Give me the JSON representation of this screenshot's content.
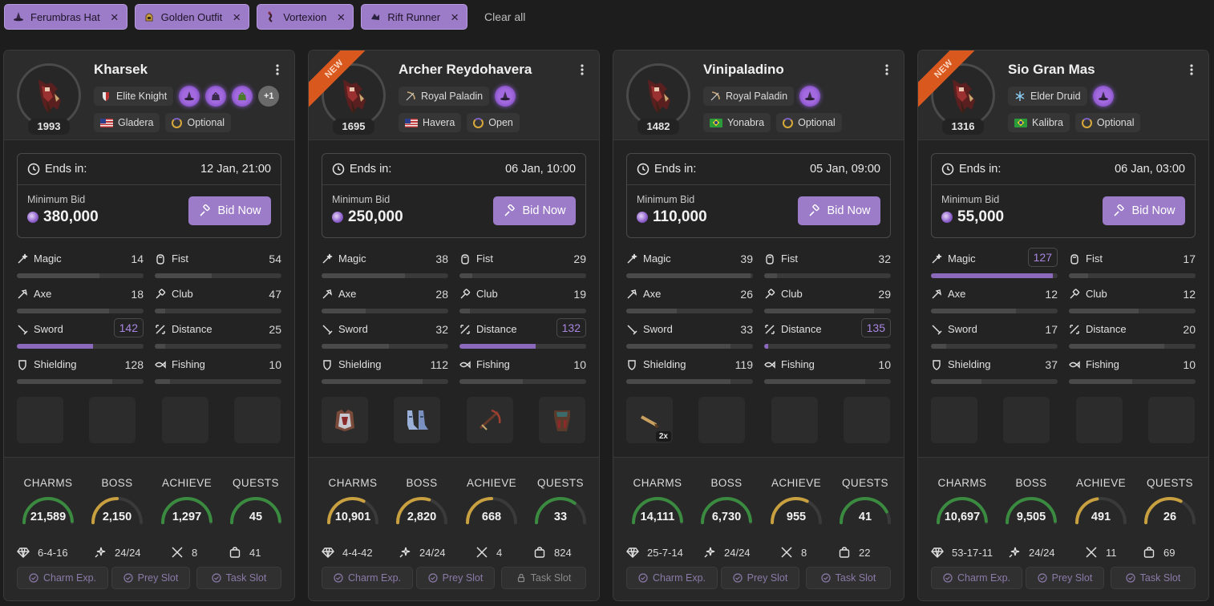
{
  "filters": [
    {
      "label": "Ferumbras Hat",
      "icon": "wizard-hat-icon"
    },
    {
      "label": "Golden Outfit",
      "icon": "golden-helmet-icon"
    },
    {
      "label": "Vortexion",
      "icon": "vortexion-mount-icon"
    },
    {
      "label": "Rift Runner",
      "icon": "rift-runner-mount-icon"
    }
  ],
  "clear_all": "Clear all",
  "labels": {
    "ends_in": "Ends in:",
    "minimum_bid": "Minimum Bid",
    "bid_now": "Bid Now",
    "new_badge": "NEW",
    "charms": "CHARMS",
    "boss": "BOSS",
    "achieve": "ACHIEVE",
    "quests": "QUESTS",
    "charm_exp": "Charm Exp.",
    "prey_slot": "Prey Slot",
    "task_slot": "Task Slot"
  },
  "colors": {
    "accent": "#9c7cc8",
    "ribbon": "#d8581e",
    "gauge_green": "#3a8a40",
    "gauge_gold": "#c8a040"
  },
  "cards": [
    {
      "name": "Kharsek",
      "level": "1993",
      "is_new": false,
      "vocation": "Elite Knight",
      "vocation_icon": "shield-icon",
      "server": "Gladera",
      "flag": "us",
      "pvp": "Optional",
      "imbue_orbs": [
        "wizard-hat-icon",
        "bag-icon",
        "green-bag-icon"
      ],
      "more_orbs": "+1",
      "ends_date": "12 Jan, 21:00",
      "min_bid": "380,000",
      "skills": [
        {
          "name": "Magic",
          "value": "14",
          "level": 0.65,
          "highlight": false
        },
        {
          "name": "Fist",
          "value": "54",
          "level": 0.45,
          "highlight": false
        },
        {
          "name": "Axe",
          "value": "18",
          "level": 0.73,
          "highlight": false
        },
        {
          "name": "Club",
          "value": "47",
          "level": 0.08,
          "highlight": false
        },
        {
          "name": "Sword",
          "value": "142",
          "level": 0.6,
          "highlight": true
        },
        {
          "name": "Distance",
          "value": "25",
          "level": 0.08,
          "highlight": false
        },
        {
          "name": "Shielding",
          "value": "128",
          "level": 0.75,
          "highlight": false
        },
        {
          "name": "Fishing",
          "value": "10",
          "level": 0.12,
          "highlight": false
        }
      ],
      "items": [],
      "stats": [
        {
          "key": "charms",
          "value": "21,589",
          "ratio": 0.98,
          "color": "green"
        },
        {
          "key": "boss",
          "value": "2,150",
          "ratio": 0.5,
          "color": "gold"
        },
        {
          "key": "achieve",
          "value": "1,297",
          "ratio": 0.98,
          "color": "green"
        },
        {
          "key": "quests",
          "value": "45",
          "ratio": 0.98,
          "color": "green"
        }
      ],
      "minis": {
        "gems": "6-4-16",
        "prey": "24/24",
        "hunting": "8",
        "store": "41"
      },
      "perks": {
        "charm_exp": true,
        "prey_slot": true,
        "task_slot": true
      }
    },
    {
      "name": "Archer Reydohavera",
      "level": "1695",
      "is_new": true,
      "vocation": "Royal Paladin",
      "vocation_icon": "bow-icon",
      "server": "Havera",
      "flag": "us",
      "pvp": "Open",
      "imbue_orbs": [
        "wizard-hat-icon"
      ],
      "more_orbs": "",
      "ends_date": "06 Jan, 10:00",
      "min_bid": "250,000",
      "skills": [
        {
          "name": "Magic",
          "value": "38",
          "level": 0.66,
          "highlight": false
        },
        {
          "name": "Fist",
          "value": "29",
          "level": 0.1,
          "highlight": false
        },
        {
          "name": "Axe",
          "value": "28",
          "level": 0.35,
          "highlight": false
        },
        {
          "name": "Club",
          "value": "19",
          "level": 0.08,
          "highlight": false
        },
        {
          "name": "Sword",
          "value": "32",
          "level": 0.53,
          "highlight": false
        },
        {
          "name": "Distance",
          "value": "132",
          "level": 0.6,
          "highlight": true
        },
        {
          "name": "Shielding",
          "value": "112",
          "level": 0.8,
          "highlight": false
        },
        {
          "name": "Fishing",
          "value": "10",
          "level": 0.5,
          "highlight": false
        }
      ],
      "items": [
        {
          "icon": "armor-icon",
          "count": ""
        },
        {
          "icon": "boots-icon",
          "count": ""
        },
        {
          "icon": "crossbow-icon",
          "count": ""
        },
        {
          "icon": "legs-icon",
          "count": ""
        }
      ],
      "stats": [
        {
          "key": "charms",
          "value": "10,901",
          "ratio": 0.65,
          "color": "gold"
        },
        {
          "key": "boss",
          "value": "2,820",
          "ratio": 0.6,
          "color": "gold"
        },
        {
          "key": "achieve",
          "value": "668",
          "ratio": 0.5,
          "color": "gold"
        },
        {
          "key": "quests",
          "value": "33",
          "ratio": 0.7,
          "color": "green"
        }
      ],
      "minis": {
        "gems": "4-4-42",
        "prey": "24/24",
        "hunting": "4",
        "store": "824"
      },
      "perks": {
        "charm_exp": true,
        "prey_slot": true,
        "task_slot": false
      }
    },
    {
      "name": "Vinipaladino",
      "level": "1482",
      "is_new": false,
      "vocation": "Royal Paladin",
      "vocation_icon": "bow-icon",
      "server": "Yonabra",
      "flag": "br",
      "pvp": "Optional",
      "imbue_orbs": [
        "wizard-hat-icon"
      ],
      "more_orbs": "",
      "ends_date": "05 Jan, 09:00",
      "min_bid": "110,000",
      "skills": [
        {
          "name": "Magic",
          "value": "39",
          "level": 0.98,
          "highlight": false
        },
        {
          "name": "Fist",
          "value": "32",
          "level": 0.1,
          "highlight": false
        },
        {
          "name": "Axe",
          "value": "26",
          "level": 0.4,
          "highlight": false
        },
        {
          "name": "Club",
          "value": "29",
          "level": 0.87,
          "highlight": false
        },
        {
          "name": "Sword",
          "value": "33",
          "level": 0.82,
          "highlight": false
        },
        {
          "name": "Distance",
          "value": "135",
          "level": 0.03,
          "highlight": true
        },
        {
          "name": "Shielding",
          "value": "119",
          "level": 0.82,
          "highlight": false
        },
        {
          "name": "Fishing",
          "value": "10",
          "level": 0.8,
          "highlight": false
        }
      ],
      "items": [
        {
          "icon": "arrow-ammo-icon",
          "count": "2x"
        }
      ],
      "stats": [
        {
          "key": "charms",
          "value": "14,111",
          "ratio": 0.98,
          "color": "green"
        },
        {
          "key": "boss",
          "value": "6,730",
          "ratio": 0.98,
          "color": "green"
        },
        {
          "key": "achieve",
          "value": "955",
          "ratio": 0.65,
          "color": "gold"
        },
        {
          "key": "quests",
          "value": "41",
          "ratio": 0.85,
          "color": "green"
        }
      ],
      "minis": {
        "gems": "25-7-14",
        "prey": "24/24",
        "hunting": "8",
        "store": "22"
      },
      "perks": {
        "charm_exp": true,
        "prey_slot": true,
        "task_slot": true
      }
    },
    {
      "name": "Sio Gran Mas",
      "level": "1316",
      "is_new": true,
      "vocation": "Elder Druid",
      "vocation_icon": "snowflake-icon",
      "server": "Kalibra",
      "flag": "br",
      "pvp": "Optional",
      "imbue_orbs": [
        "wizard-hat-icon"
      ],
      "more_orbs": "",
      "ends_date": "06 Jan, 03:00",
      "min_bid": "55,000",
      "skills": [
        {
          "name": "Magic",
          "value": "127",
          "level": 0.96,
          "highlight": true
        },
        {
          "name": "Fist",
          "value": "17",
          "level": 0.15,
          "highlight": false
        },
        {
          "name": "Axe",
          "value": "12",
          "level": 0.67,
          "highlight": false
        },
        {
          "name": "Club",
          "value": "12",
          "level": 0.55,
          "highlight": false
        },
        {
          "name": "Sword",
          "value": "17",
          "level": 0.12,
          "highlight": false
        },
        {
          "name": "Distance",
          "value": "20",
          "level": 0.75,
          "highlight": false
        },
        {
          "name": "Shielding",
          "value": "37",
          "level": 0.4,
          "highlight": false
        },
        {
          "name": "Fishing",
          "value": "10",
          "level": 0.5,
          "highlight": false
        }
      ],
      "items": [],
      "stats": [
        {
          "key": "charms",
          "value": "10,697",
          "ratio": 0.98,
          "color": "green"
        },
        {
          "key": "boss",
          "value": "9,505",
          "ratio": 0.98,
          "color": "green"
        },
        {
          "key": "achieve",
          "value": "491",
          "ratio": 0.45,
          "color": "gold"
        },
        {
          "key": "quests",
          "value": "26",
          "ratio": 0.65,
          "color": "gold"
        }
      ],
      "minis": {
        "gems": "53-17-11",
        "prey": "24/24",
        "hunting": "11",
        "store": "69"
      },
      "perks": {
        "charm_exp": true,
        "prey_slot": true,
        "task_slot": true
      }
    }
  ]
}
